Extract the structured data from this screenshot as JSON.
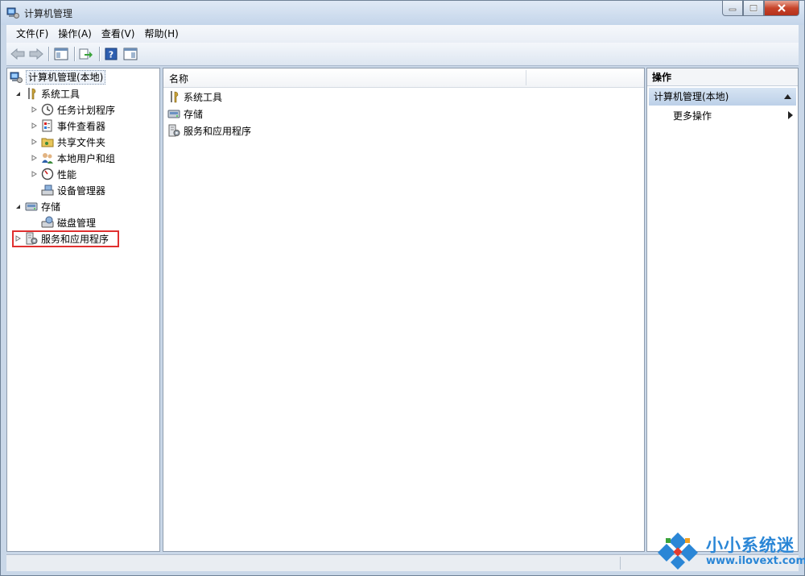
{
  "window": {
    "title": "计算机管理"
  },
  "menu": [
    "文件(F)",
    "操作(A)",
    "查看(V)",
    "帮助(H)"
  ],
  "tree": {
    "root": "计算机管理(本地)",
    "system_tools": "系统工具",
    "task_scheduler": "任务计划程序",
    "event_viewer": "事件查看器",
    "shared_folders": "共享文件夹",
    "local_users": "本地用户和组",
    "performance": "性能",
    "device_manager": "设备管理器",
    "storage": "存储",
    "disk_management": "磁盘管理",
    "services_apps": "服务和应用程序"
  },
  "center": {
    "column_name": "名称",
    "items": [
      "系统工具",
      "存储",
      "服务和应用程序"
    ]
  },
  "actions": {
    "title": "操作",
    "section": "计算机管理(本地)",
    "more": "更多操作"
  },
  "watermark": {
    "brand": "小小系统迷",
    "url": "www.ilovext.com"
  },
  "colors": {
    "highlight": "#e03030",
    "watermark": "#2a86d6"
  }
}
